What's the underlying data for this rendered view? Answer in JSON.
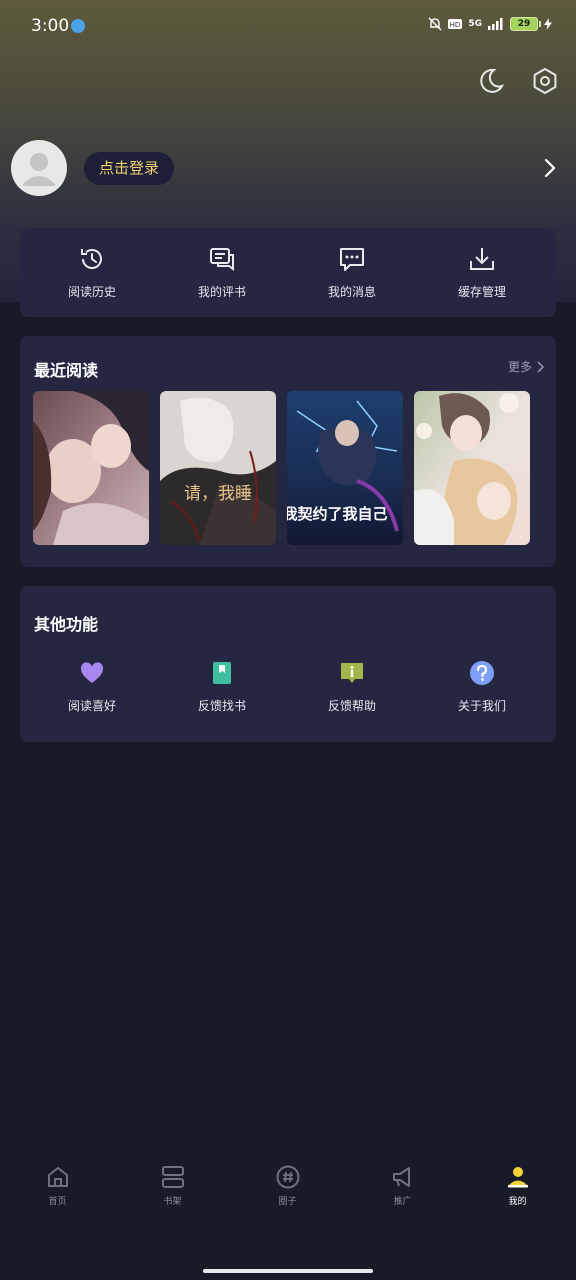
{
  "status_bar": {
    "time": "3:00",
    "battery": "29",
    "network": "5G"
  },
  "profile": {
    "login_label": "点击登录"
  },
  "quick_actions": [
    {
      "label": "阅读历史",
      "icon": "history-icon"
    },
    {
      "label": "我的评书",
      "icon": "comment-icon"
    },
    {
      "label": "我的消息",
      "icon": "message-icon"
    },
    {
      "label": "缓存管理",
      "icon": "download-icon"
    }
  ],
  "recent": {
    "title": "最近阅读",
    "more_label": "更多",
    "books": [
      {
        "cover_text": ""
      },
      {
        "cover_text": "请，我睡"
      },
      {
        "cover_text": "我契约了我自己"
      },
      {
        "cover_text": ""
      }
    ]
  },
  "other": {
    "title": "其他功能",
    "items": [
      {
        "label": "阅读喜好",
        "icon": "heart-icon",
        "color": "#a887f0"
      },
      {
        "label": "反馈找书",
        "icon": "bookmark-icon",
        "color": "#3fbfa0"
      },
      {
        "label": "反馈帮助",
        "icon": "info-icon",
        "color": "#9fb84a"
      },
      {
        "label": "关于我们",
        "icon": "question-icon",
        "color": "#7f9ef5"
      }
    ]
  },
  "tabbar": {
    "items": [
      {
        "label": "首页",
        "active": false
      },
      {
        "label": "书架",
        "active": false
      },
      {
        "label": "圈子",
        "active": false
      },
      {
        "label": "推广",
        "active": false
      },
      {
        "label": "我的",
        "active": true
      }
    ]
  },
  "colors": {
    "background": "#181a28",
    "card": "#24273f",
    "accent": "#f2d26b"
  }
}
